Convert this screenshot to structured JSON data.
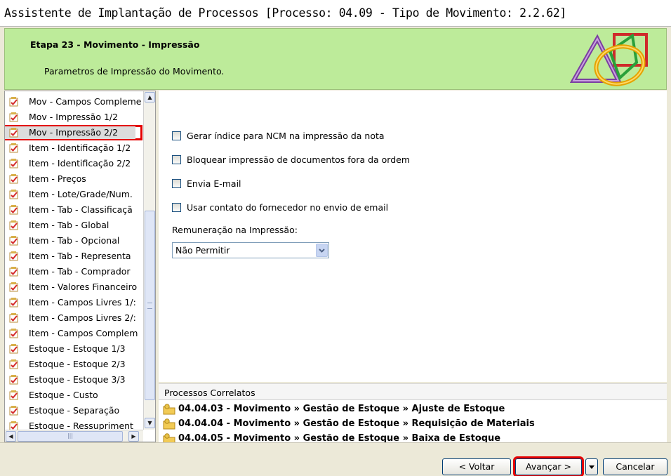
{
  "window": {
    "title": "Assistente de Implantação de Processos [Processo: 04.09 - Tipo de Movimento: 2.2.62]"
  },
  "banner": {
    "step": "Etapa 23 - Movimento - Impressão",
    "subtitle": "Parametros de Impressão do Movimento."
  },
  "nav": {
    "items": [
      {
        "label": "Mov - Campos Compleme"
      },
      {
        "label": "Mov - Impressão 1/2"
      },
      {
        "label": "Mov - Impressão 2/2",
        "selected": true
      },
      {
        "label": "Item - Identificação 1/2"
      },
      {
        "label": "Item - Identificação 2/2"
      },
      {
        "label": "Item - Preços"
      },
      {
        "label": "Item - Lote/Grade/Num."
      },
      {
        "label": "Item - Tab - Classificaçã"
      },
      {
        "label": "Item - Tab - Global"
      },
      {
        "label": "Item - Tab - Opcional"
      },
      {
        "label": "Item - Tab - Representa"
      },
      {
        "label": "Item - Tab - Comprador"
      },
      {
        "label": "Item - Valores Financeiro"
      },
      {
        "label": "Item - Campos Livres 1/:"
      },
      {
        "label": "Item - Campos Livres 2/:"
      },
      {
        "label": "Item - Campos Complem"
      },
      {
        "label": "Estoque - Estoque 1/3"
      },
      {
        "label": "Estoque - Estoque 2/3"
      },
      {
        "label": "Estoque - Estoque 3/3"
      },
      {
        "label": "Estoque - Custo"
      },
      {
        "label": "Estoque - Separação"
      },
      {
        "label": "Estoque - Ressupriment"
      }
    ]
  },
  "options": {
    "chk_ncm": "Gerar índice para NCM na impressão da nota",
    "chk_bloquear": "Bloquear impressão de documentos fora da ordem",
    "chk_email": "Envia E-mail",
    "chk_contato": "Usar contato do fornecedor no envio de email",
    "remuneracao_label": "Remuneração na Impressão:",
    "remuneracao_value": "Não Permitir"
  },
  "related": {
    "header": "Processos Correlatos",
    "items": [
      "04.04.03 - Movimento » Gestão de Estoque » Ajuste de Estoque",
      "04.04.04 - Movimento » Gestão de Estoque » Requisição de Materiais",
      "04.04.05 - Movimento » Gestão de Estoque » Baixa de Estoque"
    ]
  },
  "buttons": {
    "back": "< Voltar",
    "next": "Avançar >",
    "cancel": "Cancelar"
  },
  "colors": {
    "banner_green": "#bdeb9a",
    "highlight_red": "#e40000"
  }
}
